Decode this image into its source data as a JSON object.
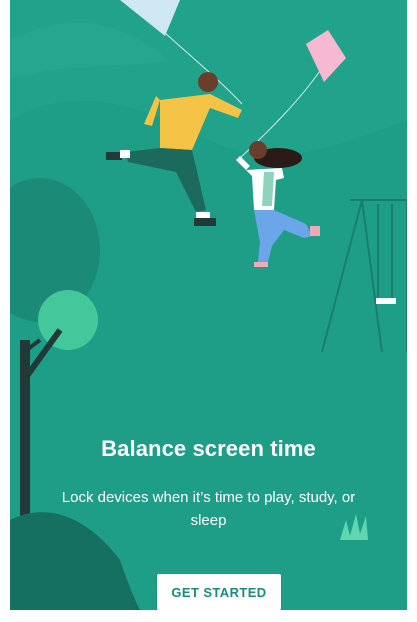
{
  "onboarding": {
    "title": "Balance screen time",
    "description": "Lock devices when it’s time to play, study, or sleep",
    "cta_label": "GET STARTED"
  },
  "icons": {
    "illustration": "family-playing-kites-illustration"
  },
  "colors": {
    "background": "#1f9e87",
    "button_bg": "#ffffff",
    "button_text": "#1a8c77",
    "text": "#ffffff"
  }
}
